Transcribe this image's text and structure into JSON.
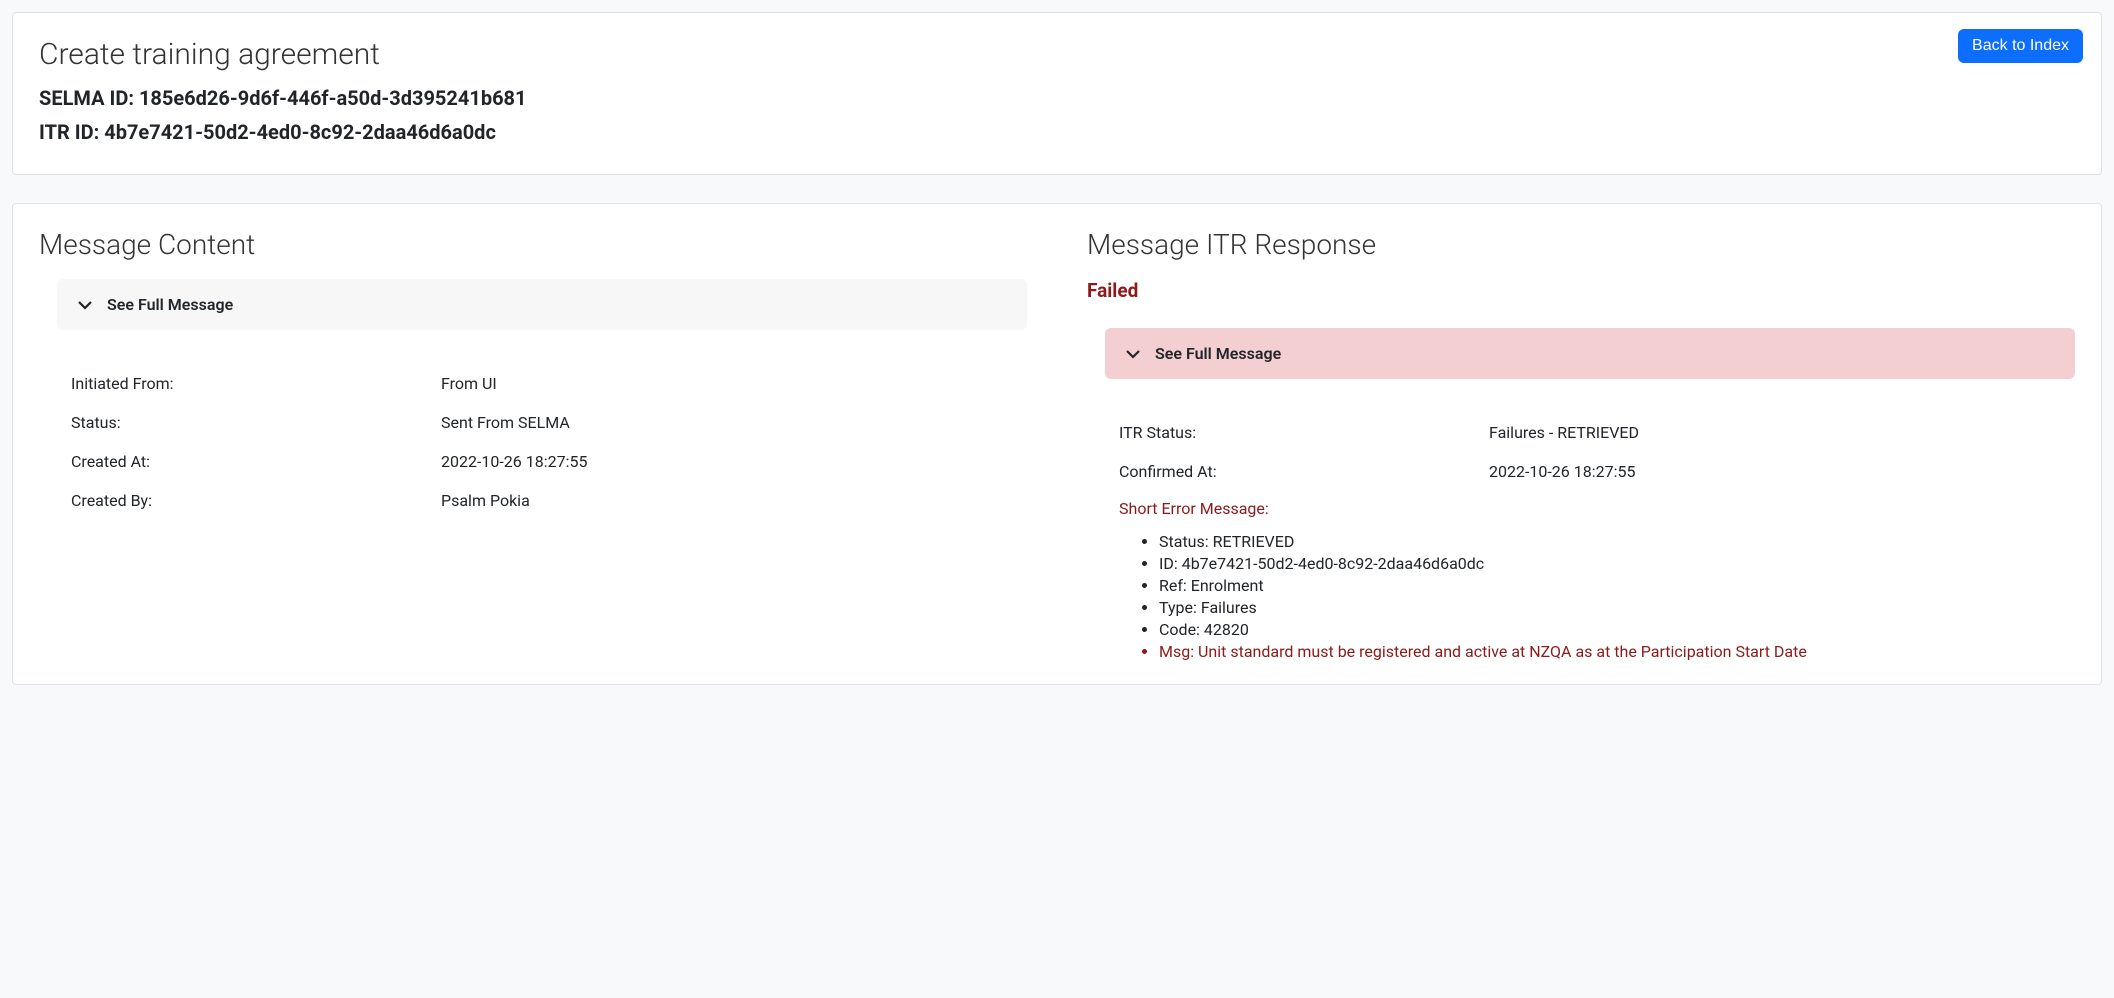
{
  "header": {
    "title": "Create training agreement",
    "selma_label": "SELMA ID:",
    "selma_id": "185e6d26-9d6f-446f-a50d-3d395241b681",
    "itr_label": "ITR ID:",
    "itr_id": "4b7e7421-50d2-4ed0-8c92-2daa46d6a0dc",
    "back_button": "Back to Index"
  },
  "left": {
    "title": "Message Content",
    "accordion_label": "See Full Message",
    "rows": {
      "initiated_from_label": "Initiated From:",
      "initiated_from_value": "From UI",
      "status_label": "Status:",
      "status_value": "Sent From SELMA",
      "created_at_label": "Created At:",
      "created_at_value": "2022-10-26 18:27:55",
      "created_by_label": "Created By:",
      "created_by_value": "Psalm Pokia"
    }
  },
  "right": {
    "title": "Message ITR Response",
    "failed": "Failed",
    "accordion_label": "See Full Message",
    "rows": {
      "itr_status_label": "ITR Status:",
      "itr_status_value": "Failures - RETRIEVED",
      "confirmed_at_label": "Confirmed At:",
      "confirmed_at_value": "2022-10-26 18:27:55"
    },
    "short_error_label": "Short Error Message:",
    "errors": {
      "status": "Status: RETRIEVED",
      "id": "ID: 4b7e7421-50d2-4ed0-8c92-2daa46d6a0dc",
      "ref": "Ref: Enrolment",
      "type": "Type: Failures",
      "code": "Code: 42820",
      "msg": "Msg: Unit standard must be registered and active at NZQA as at the Participation Start Date"
    }
  }
}
